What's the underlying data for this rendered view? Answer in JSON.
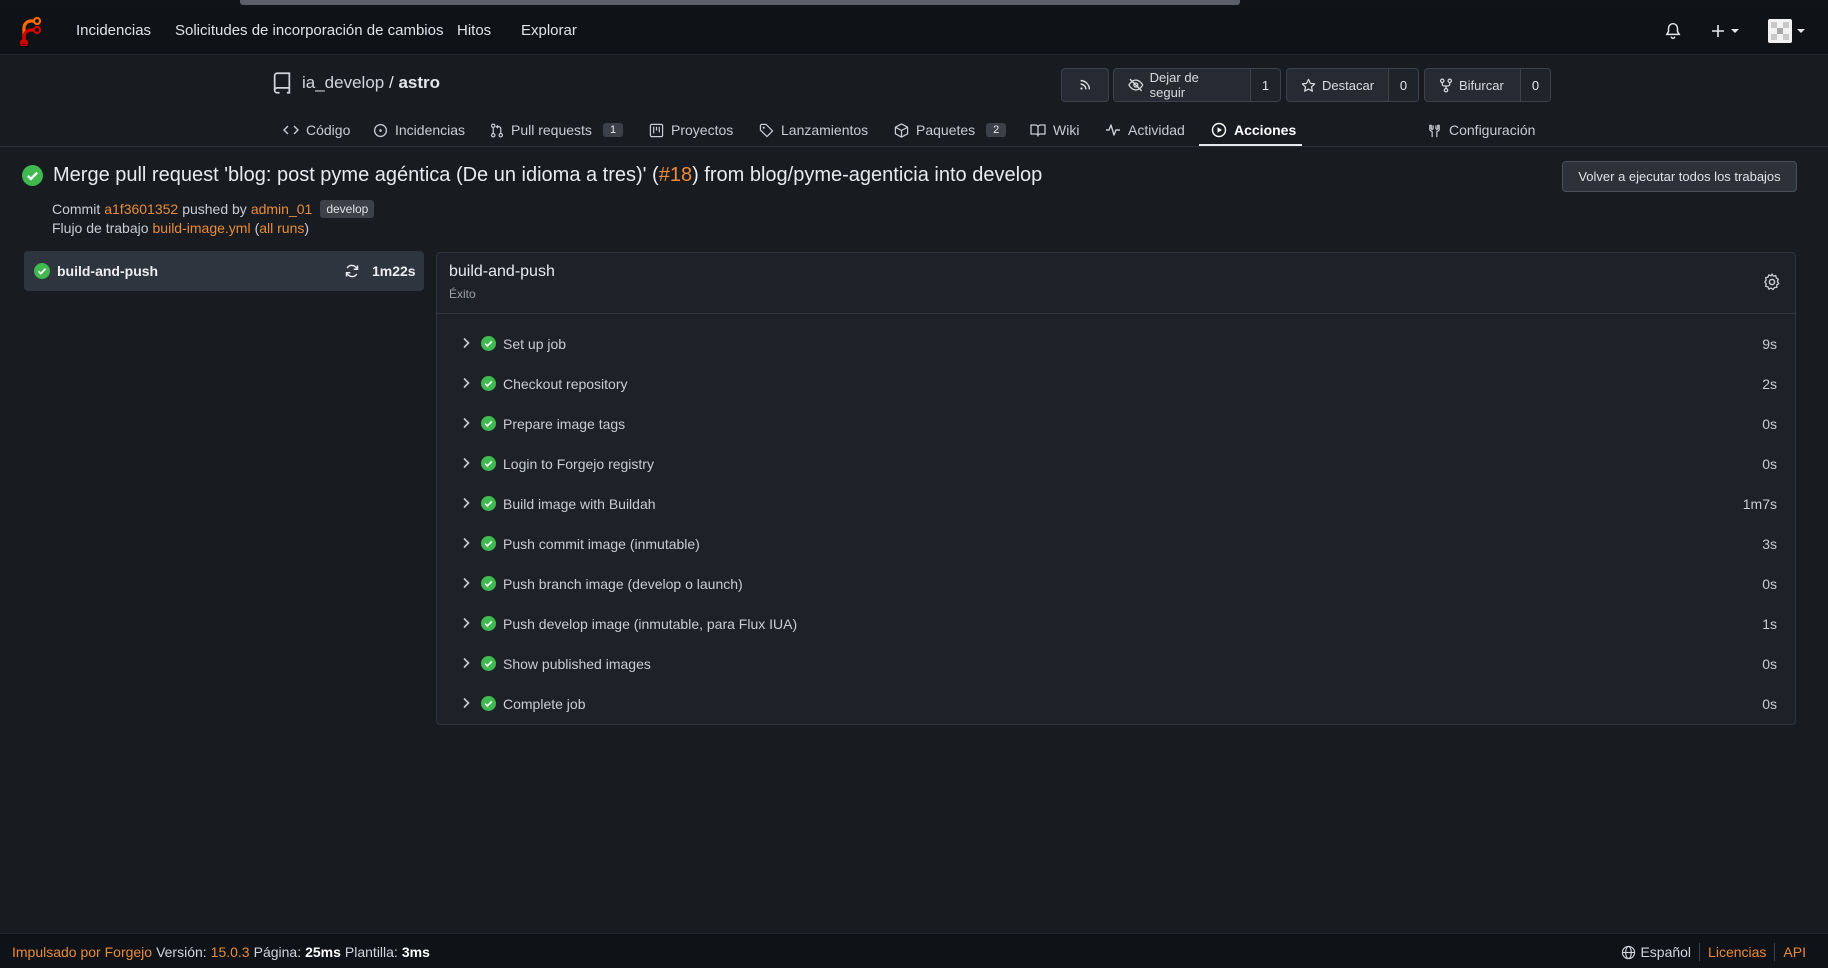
{
  "navbar": {
    "links": [
      "Incidencias",
      "Solicitudes de incorporación de cambios",
      "Hitos",
      "Explorar"
    ]
  },
  "repo": {
    "owner": "ia_develop",
    "separator": "/",
    "name": "astro",
    "unwatch_label": "Dejar de seguir",
    "watch_count": "1",
    "star_label": "Destacar",
    "star_count": "0",
    "fork_label": "Bifurcar",
    "fork_count": "0"
  },
  "tabs": {
    "code": "Código",
    "issues": "Incidencias",
    "pulls": "Pull requests",
    "pulls_count": "1",
    "projects": "Proyectos",
    "releases": "Lanzamientos",
    "packages": "Paquetes",
    "packages_count": "2",
    "wiki": "Wiki",
    "activity": "Actividad",
    "actions": "Acciones",
    "settings": "Configuración"
  },
  "run": {
    "title_prefix": "Merge pull request 'blog: post pyme agéntica (De un idioma a tres)' (",
    "pr_ref": "#18",
    "title_suffix": ") from blog/pyme-agenticia into develop",
    "rerun_label": "Volver a ejecutar todos los trabajos",
    "commit_label": "Commit",
    "commit_sha": "a1f3601352",
    "pushed_by": "pushed by",
    "author": "admin_01",
    "branch": "develop",
    "workflow_label": "Flujo de trabajo",
    "workflow_file": "build-image.yml",
    "all_runs_open": "(",
    "all_runs": "all runs",
    "all_runs_close": ")"
  },
  "job_list": {
    "name": "build-and-push",
    "duration": "1m22s"
  },
  "job": {
    "title": "build-and-push",
    "status": "Éxito",
    "steps": [
      {
        "label": "Set up job",
        "time": "9s"
      },
      {
        "label": "Checkout repository",
        "time": "2s"
      },
      {
        "label": "Prepare image tags",
        "time": "0s"
      },
      {
        "label": "Login to Forgejo registry",
        "time": "0s"
      },
      {
        "label": "Build image with Buildah",
        "time": "1m7s"
      },
      {
        "label": "Push commit image (inmutable)",
        "time": "3s"
      },
      {
        "label": "Push branch image (develop o launch)",
        "time": "0s"
      },
      {
        "label": "Push develop image (inmutable, para Flux IUA)",
        "time": "1s"
      },
      {
        "label": "Show published images",
        "time": "0s"
      },
      {
        "label": "Complete job",
        "time": "0s"
      }
    ]
  },
  "footer": {
    "powered": "Impulsado por Forgejo",
    "version_label": "Versión:",
    "version": "15.0.3",
    "page_label": "Página:",
    "page_time": "25ms",
    "template_label": "Plantilla:",
    "template_time": "3ms",
    "language": "Español",
    "licenses": "Licencias",
    "api": "API"
  },
  "colors": {
    "accent": "#e88b3a",
    "success": "#3fb950",
    "background": "#181c21"
  }
}
